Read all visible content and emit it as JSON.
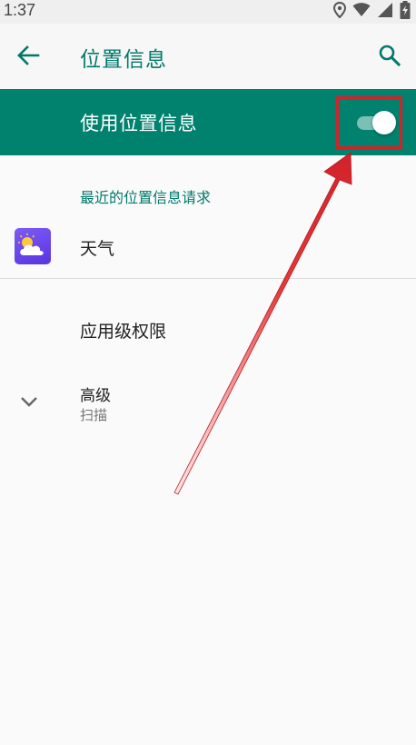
{
  "status_bar": {
    "time": "1:37",
    "icons": [
      "location-icon",
      "wifi-icon",
      "signal-icon",
      "battery-charging-icon"
    ]
  },
  "app_bar": {
    "back_icon": "arrow-back-icon",
    "title": "位置信息",
    "search_icon": "search-icon"
  },
  "master_switch": {
    "label": "使用位置信息",
    "state": "on"
  },
  "recent_requests": {
    "header": "最近的位置信息请求",
    "apps": [
      {
        "name": "天气",
        "icon": "weather-app-icon"
      }
    ]
  },
  "app_permissions": {
    "label": "应用级权限"
  },
  "advanced": {
    "title": "高级",
    "subtitle": "扫描",
    "icon": "chevron-down-icon"
  },
  "colors": {
    "accent": "#00796b",
    "switch_bar": "#00826f",
    "annotation": "#d2222a"
  }
}
